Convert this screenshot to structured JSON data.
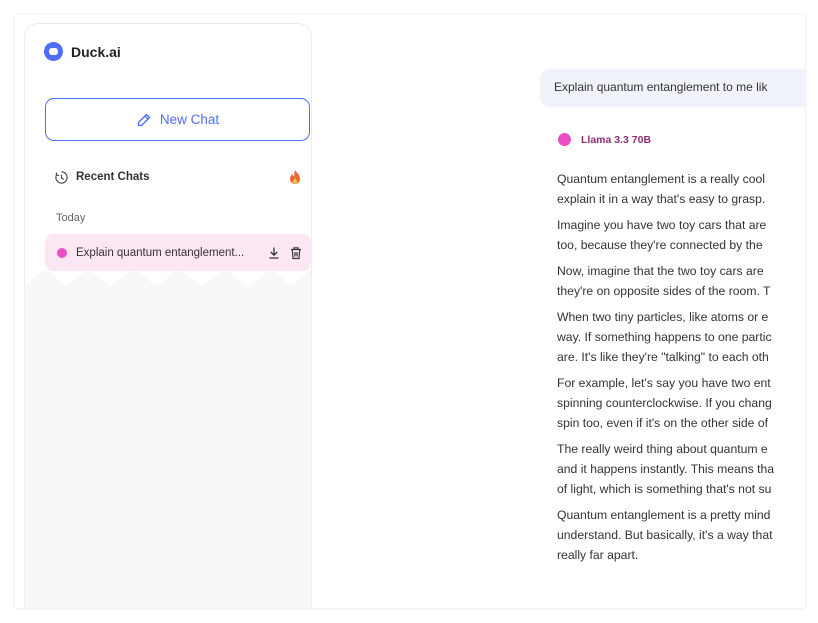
{
  "sidebar": {
    "brand": "Duck.ai",
    "new_chat_label": "New Chat",
    "recent_label": "Recent Chats",
    "section_today": "Today",
    "chats": [
      {
        "title": "Explain quantum entanglement..."
      }
    ]
  },
  "conversation": {
    "user_message": "Explain quantum entanglement to me lik",
    "model_name": "Llama 3.3 70B",
    "answer_lines": [
      [
        "Quantum entanglement is a really cool",
        "explain it in a way that's easy to grasp."
      ],
      [
        "Imagine you have two toy cars that are",
        "too, because they're connected by the"
      ],
      [
        "Now, imagine that the two toy cars are",
        "they're on opposite sides of the room. T"
      ],
      [
        "When two tiny particles, like atoms or e",
        "way. If something happens to one partic",
        "are. It's like they're \"talking\" to each oth"
      ],
      [
        "For example, let's say you have two ent",
        "spinning counterclockwise. If you chang",
        "spin too, even if it's on the other side of"
      ],
      [
        "The really weird thing about quantum e",
        "and it happens instantly. This means tha",
        "of light, which is something that's not su"
      ],
      [
        "Quantum entanglement is a pretty mind",
        "understand. But basically, it's a way that",
        "really far apart."
      ]
    ]
  },
  "colors": {
    "accent": "#4f6ef7",
    "model_dot": "#e94fc2",
    "selected_chat_bg": "#fbe6f4",
    "fire": "#f2622e"
  },
  "icons": [
    "duck-logo-icon",
    "pencil-icon",
    "clock-icon",
    "fire-icon",
    "download-icon",
    "trash-icon"
  ]
}
